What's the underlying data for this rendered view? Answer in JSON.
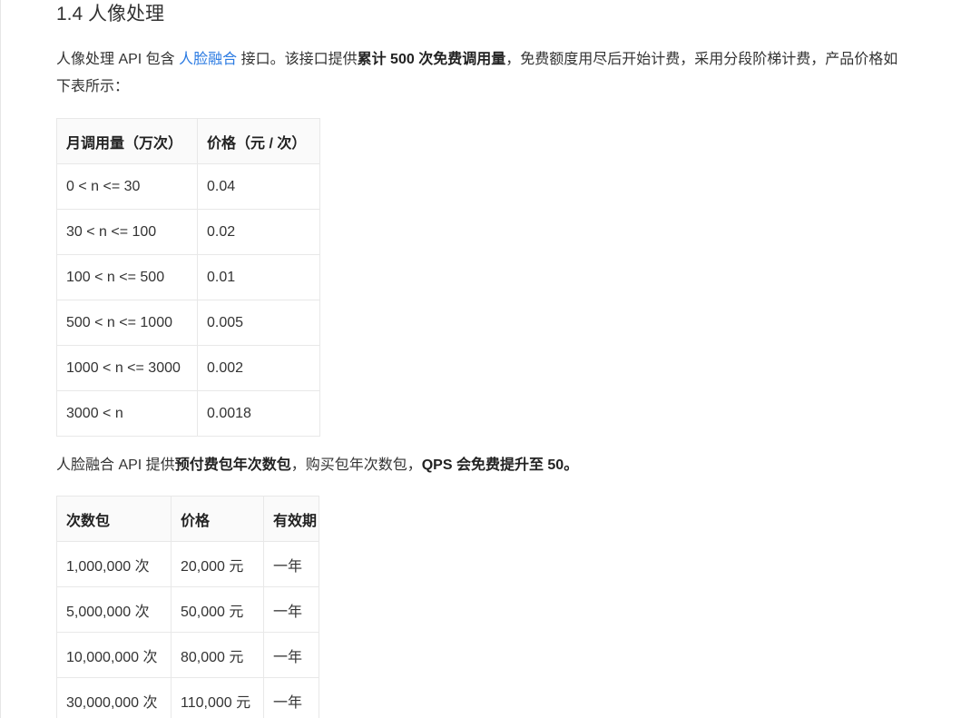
{
  "section": {
    "title": "1.4 人像处理"
  },
  "intro": {
    "part1": "人像处理 API 包含 ",
    "link": "人脸融合",
    "part2": " 接口。该接口提供",
    "bold1": "累计 500 次免费调用量",
    "part3": "，免费额度用尽后开始计费，采用分段阶梯计费，产品价格如下表所示："
  },
  "tier_table": {
    "headers": [
      "月调用量（万次）",
      "价格（元 / 次）"
    ],
    "rows": [
      [
        "0 < n <= 30",
        "0.04"
      ],
      [
        "30 < n <= 100",
        "0.02"
      ],
      [
        "100 < n <= 500",
        "0.01"
      ],
      [
        "500 < n <= 1000",
        "0.005"
      ],
      [
        "1000 < n <= 3000",
        "0.002"
      ],
      [
        "3000 < n",
        "0.0018"
      ]
    ]
  },
  "package_note": {
    "part1": "人脸融合 API 提供",
    "bold1": "预付费包年次数包",
    "part2": "，购买包年次数包，",
    "bold2": "QPS 会免费提升至 50。"
  },
  "package_table": {
    "headers": [
      "次数包",
      "价格",
      "有效期"
    ],
    "rows": [
      [
        "1,000,000 次",
        "20,000 元",
        "一年"
      ],
      [
        "5,000,000 次",
        "50,000 元",
        "一年"
      ],
      [
        "10,000,000 次",
        "80,000 元",
        "一年"
      ],
      [
        "30,000,000 次",
        "110,000 元",
        "一年"
      ]
    ]
  },
  "colors": {
    "link": "#2a7ae2",
    "text": "#333333",
    "border": "#e8e8e8",
    "header_bg": "#fafafa"
  }
}
